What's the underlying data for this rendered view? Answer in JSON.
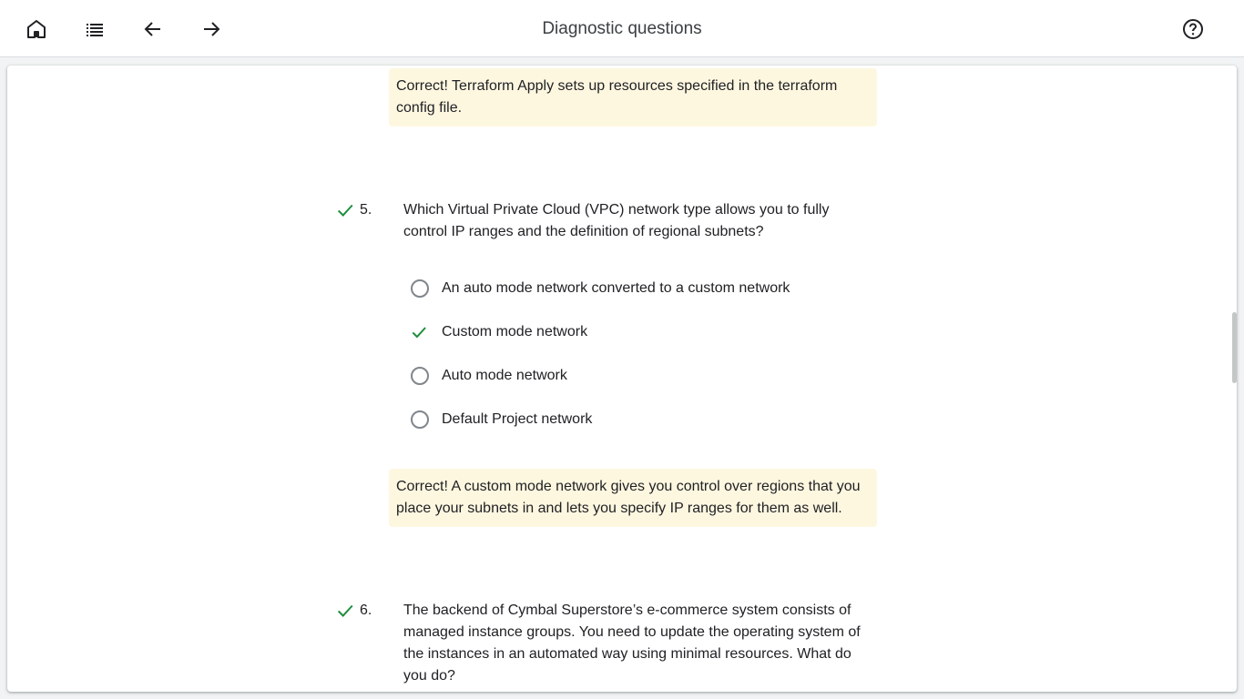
{
  "header": {
    "title": "Diagnostic questions",
    "icons": {
      "home": "home-icon",
      "list": "list-icon",
      "back": "arrow-back-icon",
      "forward": "arrow-forward-icon",
      "help": "help-icon"
    }
  },
  "colors": {
    "accent_green": "#1e8e3e",
    "feedback_bg": "#fef7e0"
  },
  "content": {
    "prev_feedback": "Correct! Terraform Apply sets up resources specified in the terraform config file.",
    "question5": {
      "number": "5.",
      "status": "correct",
      "text": "Which Virtual Private Cloud (VPC) network type allows you to fully control IP ranges and the definition of regional subnets?",
      "options": [
        {
          "label": "An auto mode network converted to a custom network",
          "selected": false
        },
        {
          "label": "Custom mode network",
          "selected": true
        },
        {
          "label": "Auto mode network",
          "selected": false
        },
        {
          "label": "Default Project network",
          "selected": false
        }
      ],
      "feedback": "Correct! A custom mode network gives you control over regions that you place your subnets in and lets you specify IP ranges for them as well."
    },
    "question6": {
      "number": "6.",
      "status": "correct",
      "text": "The backend of Cymbal Superstore’s e-commerce system consists of managed instance groups. You need to update the operating system of the instances in an automated way using minimal resources. What do you do?"
    }
  }
}
